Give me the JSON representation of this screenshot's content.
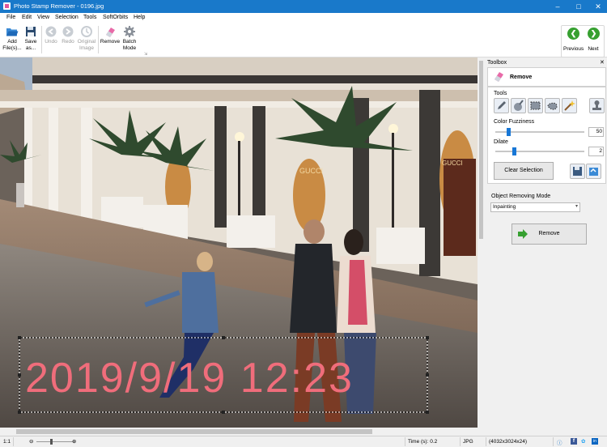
{
  "window": {
    "title": "Photo Stamp Remover - 0196.jpg"
  },
  "menu": [
    "File",
    "Edit",
    "View",
    "Selection",
    "Tools",
    "SoftOrbits",
    "Help"
  ],
  "toolbar": {
    "add_files": [
      "Add",
      "File(s)..."
    ],
    "save_as": [
      "Save",
      "as..."
    ],
    "undo": "Undo",
    "redo": "Redo",
    "original_image": [
      "Original",
      "Image"
    ],
    "remove": "Remove",
    "batch_mode": [
      "Batch",
      "Mode"
    ],
    "previous": "Previous",
    "next": "Next"
  },
  "image": {
    "stamp_text": "2019/9/19  12:23",
    "shop_sign": "GUCCI",
    "shop_sign_2": "GUCCI",
    "colors": {
      "sky": "#a6b6c8",
      "building": "#e8e1d6",
      "stamp": "#f06d7b"
    }
  },
  "toolbox": {
    "header": "Toolbox",
    "section_title": "Remove",
    "tools_label": "Tools",
    "color_fuzziness_label": "Color Fuzziness",
    "color_fuzziness_value": "50",
    "color_fuzziness_level": 0.13,
    "dilate_label": "Dilate",
    "dilate_value": "2",
    "dilate_level": 0.2,
    "clear_selection": "Clear Selection",
    "mode_label": "Object Removing Mode",
    "mode_value": "Inpainting",
    "remove_button": "Remove"
  },
  "status": {
    "zoom": "1:1",
    "time": "Time (s): 0.2",
    "format": "JPG",
    "dimensions": "(4032x3024x24)"
  },
  "accent": {
    "titlebar": "#1979ca",
    "nav_green": "#36a030",
    "slider": "#1877d6"
  }
}
